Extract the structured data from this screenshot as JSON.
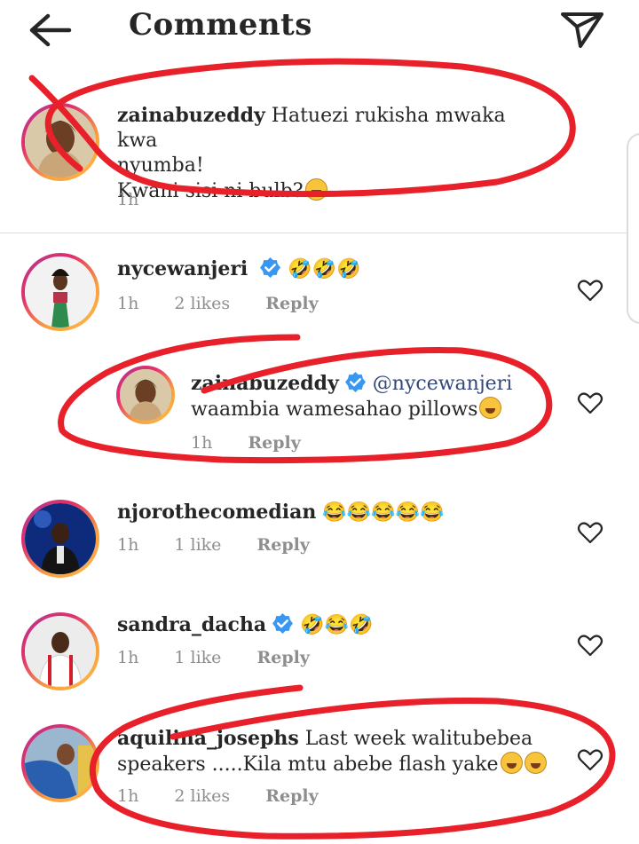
{
  "header": {
    "title": "Comments",
    "back_icon": "arrow-left-icon",
    "send_icon": "paper-plane-icon"
  },
  "caption": {
    "username": "zainabuzeddy",
    "text": "Hatuezi rukisha mwaka kwa nyumba! Kwani sisi ni bulb?",
    "line1": "Hatuezi rukisha mwaka kwa",
    "line2": "nyumba!",
    "line3": "Kwani sisi ni bulb?",
    "emoji": "😜",
    "time": "1h"
  },
  "comments": [
    {
      "username": "nycewanjeri",
      "verified": true,
      "text": "🤣🤣🤣",
      "time": "1h",
      "likes": "2 likes",
      "reply_label": "Reply"
    },
    {
      "username": "zainabuzeddy",
      "verified": true,
      "mention": "@nycewanjeri",
      "text": "waambia wamesahao pillows",
      "emoji": "😅",
      "time": "1h",
      "reply_label": "Reply",
      "is_reply": true
    },
    {
      "username": "njorothecomedian",
      "verified": false,
      "text": "😂😂😂😂😂",
      "time": "1h",
      "likes": "1 like",
      "reply_label": "Reply"
    },
    {
      "username": "sandra_dacha",
      "verified": true,
      "text": "🤣😂🤣",
      "time": "1h",
      "likes": "1 like",
      "reply_label": "Reply"
    },
    {
      "username": "aquilina_josephs",
      "verified": false,
      "text": "Last week walitubebea speakers .....Kila mtu abebe flash yake",
      "line1": "Last week walitubebea",
      "line2": "speakers .....Kila mtu abebe flash yake",
      "emoji": "😂😂",
      "time": "1h",
      "likes": "2 likes",
      "reply_label": "Reply"
    }
  ],
  "colors": {
    "annotation": "#e8202a",
    "verified": "#3897f0",
    "meta": "#8e8e8e"
  }
}
